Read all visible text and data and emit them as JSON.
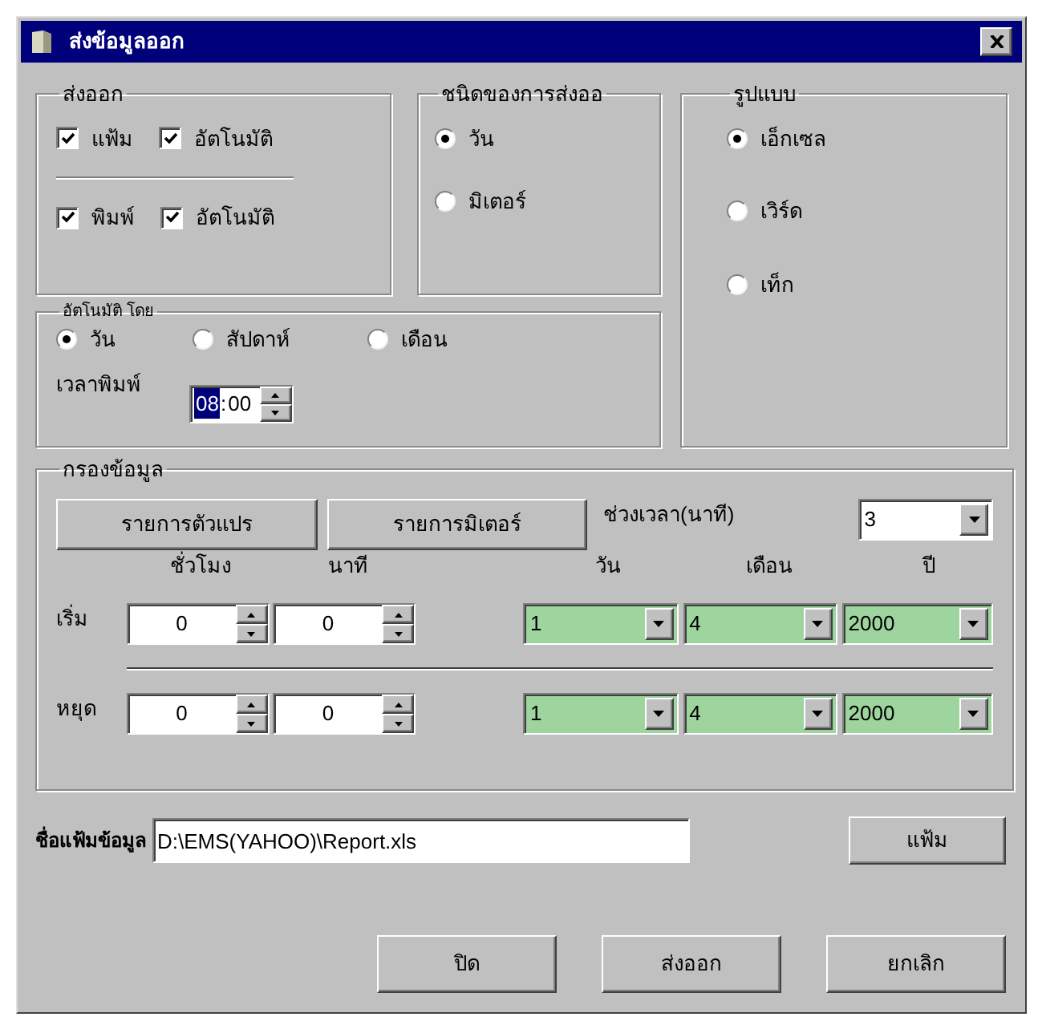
{
  "window": {
    "title": "ส่งข้อมูลออก"
  },
  "export": {
    "label": "ส่งออก",
    "rows": [
      [
        {
          "label": "แฟ้ม",
          "checked": true
        },
        {
          "label": "อัตโนมัติ",
          "checked": true
        }
      ],
      [
        {
          "label": "พิมพ์",
          "checked": true
        },
        {
          "label": "อัตโนมัติ",
          "checked": true
        }
      ]
    ]
  },
  "export_type": {
    "label": "ชนิดของการส่งออ",
    "options": [
      {
        "label": "วัน",
        "selected": true
      },
      {
        "label": "มิเตอร์",
        "selected": false
      }
    ]
  },
  "format": {
    "label": "รูปแบบ",
    "options": [
      {
        "label": "เอ็กเซล",
        "selected": true
      },
      {
        "label": "เวิร์ด",
        "selected": false
      },
      {
        "label": "เท็ก",
        "selected": false
      }
    ]
  },
  "auto_by": {
    "label": "อัตโนมัติ โดย",
    "options": [
      {
        "label": "วัน",
        "selected": true
      },
      {
        "label": "สัปดาห์",
        "selected": false
      },
      {
        "label": "เดือน",
        "selected": false
      }
    ],
    "print_time_label": "เวลาพิมพ์",
    "print_time": {
      "separator": ":",
      "segments": [
        {
          "text": "08",
          "selected": true
        },
        {
          "text": "00",
          "selected": false
        }
      ]
    }
  },
  "filter": {
    "label": "กรองข้อมูล",
    "buttons": [
      "รายการตัวแปร",
      "รายการมิเตอร์"
    ],
    "interval_label": "ช่วงเวลา(นาที)",
    "interval_value": "3",
    "headers": [
      "ชั่วโมง",
      "นาที",
      "วัน",
      "เดือน",
      "ปี"
    ],
    "rows": [
      {
        "label": "เริ่ม",
        "hour": "0",
        "minute": "0",
        "day": "1",
        "month": "4",
        "year": "2000"
      },
      {
        "label": "หยุด",
        "hour": "0",
        "minute": "0",
        "day": "1",
        "month": "4",
        "year": "2000"
      }
    ]
  },
  "file": {
    "label": "ชื่อแฟ้มข้อมูล",
    "value": "D:\\EMS(YAHOO)\\Report.xls",
    "browse_button": "แฟ้ม"
  },
  "buttons": [
    "ปิด",
    "ส่งออก",
    "ยกเลิก"
  ]
}
